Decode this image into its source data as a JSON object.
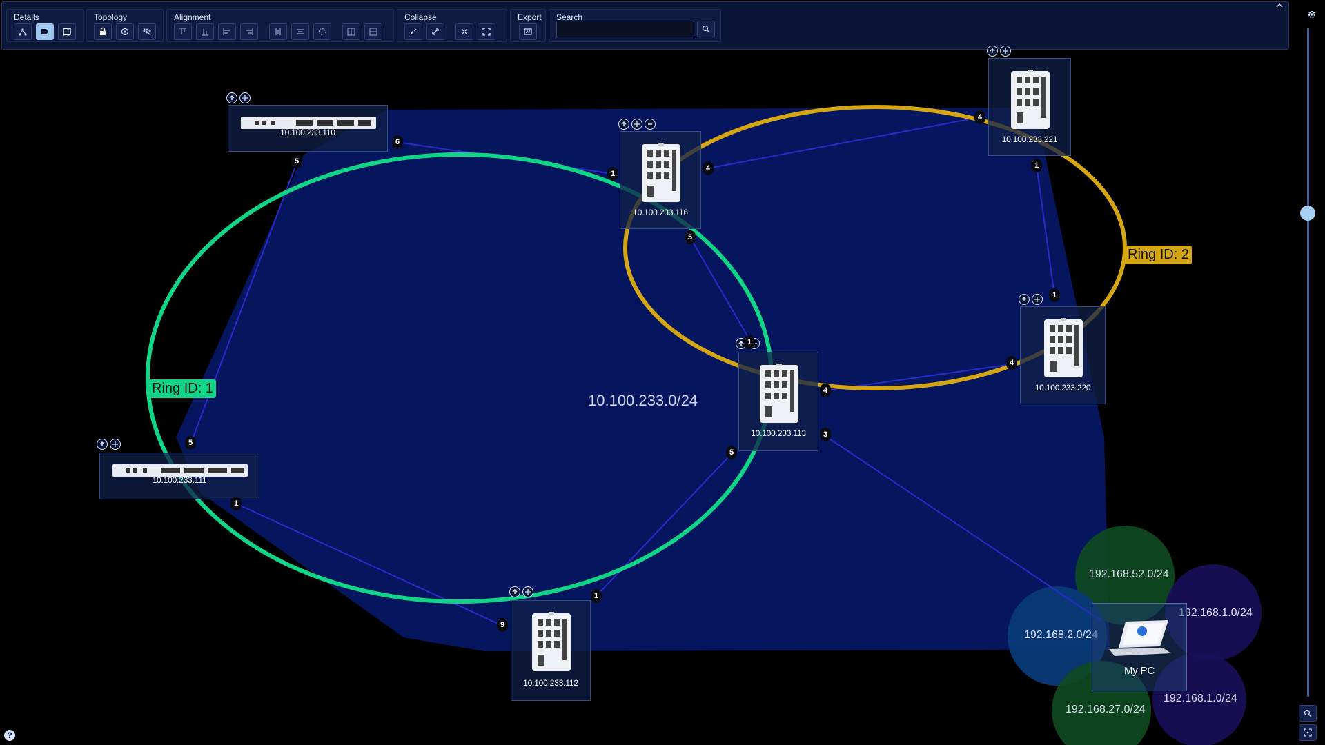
{
  "toolbar": {
    "groups": {
      "details": "Details",
      "topology": "Topology",
      "alignment": "Alignment",
      "collapse": "Collapse",
      "export": "Export",
      "search": "Search"
    },
    "search_placeholder": ""
  },
  "subnet": {
    "main": "10.100.233.0/24",
    "bubbles": [
      "192.168.52.0/24",
      "192.168.1.0/24",
      "192.168.2.0/24",
      "192.168.1.0/24",
      "192.168.27.0/24"
    ]
  },
  "rings": {
    "ring1": "Ring ID: 1",
    "ring2": "Ring ID: 2"
  },
  "nodes": {
    "n110": "10.100.233.110",
    "n111": "10.100.233.111",
    "n116": "10.100.233.116",
    "n113": "10.100.233.113",
    "n112": "10.100.233.112",
    "n221": "10.100.233.221",
    "n220": "10.100.233.220",
    "mypc": "My PC"
  },
  "ports": {
    "p110_6": "6",
    "p110_5": "5",
    "p111_5": "5",
    "p111_1": "1",
    "p116_1": "1",
    "p116_4": "4",
    "p116_5": "5",
    "p113_1": "1",
    "p113_4": "4",
    "p113_3": "3",
    "p113_5": "5",
    "p112_9": "9",
    "p112_1": "1",
    "p221_4": "4",
    "p221_1": "1",
    "p220_1": "1",
    "p220_4": "4"
  },
  "colors": {
    "ring1": "#12d486",
    "ring2": "#d4a614",
    "link": "#2a2acc",
    "subnet_fill": "#0a1a6a"
  },
  "help": "?"
}
